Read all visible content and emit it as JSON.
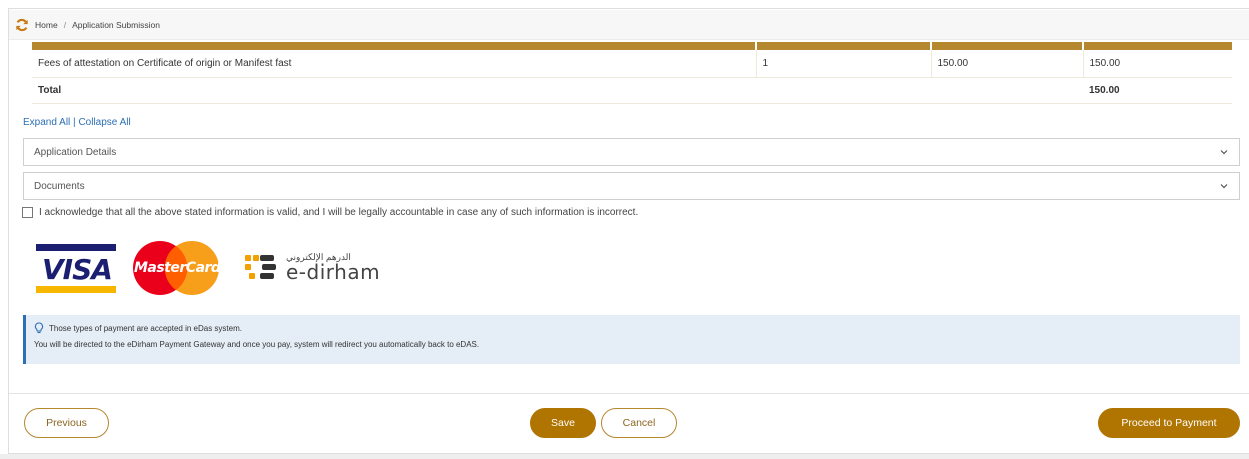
{
  "breadcrumb": {
    "home": "Home",
    "separator": "/",
    "current": "Application Submission"
  },
  "fees_table": {
    "rows": [
      {
        "description": "Fees of attestation on Certificate of origin or Manifest fast",
        "quantity": "1",
        "unit_price": "150.00",
        "amount": "150.00"
      }
    ],
    "total_label": "Total",
    "total_value": "150.00"
  },
  "links": {
    "expand_all": "Expand All",
    "separator": "|",
    "collapse_all": "Collapse All"
  },
  "sections": [
    {
      "label": "Application Details"
    },
    {
      "label": "Documents"
    }
  ],
  "acknowledgement": {
    "text": "I acknowledge that all the above stated information is valid, and I will be legally accountable in case any of such information is incorrect.",
    "checked": false
  },
  "payment_logos": {
    "visa": "VISA",
    "mastercard": "MasterCard",
    "edirham_ar": "الدرهم الإلكتروني",
    "edirham_en": "e-dirham"
  },
  "notice": {
    "line1": "Those types of payment are accepted in eDas system.",
    "line2": "You will be directed to the eDirham Payment Gateway and once you pay, system will redirect you automatically back to eDAS."
  },
  "buttons": {
    "previous": "Previous",
    "save": "Save",
    "cancel": "Cancel",
    "proceed": "Proceed to Payment"
  },
  "colors": {
    "accent": "#b5872f",
    "button_solid": "#b07400",
    "link": "#2c6fb5",
    "notice_bg": "#e5edf6"
  }
}
